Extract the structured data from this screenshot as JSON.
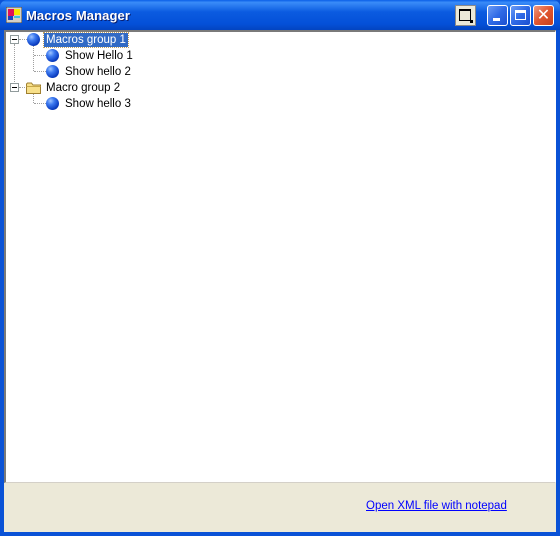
{
  "window": {
    "title": "Macros Manager",
    "title_icon": "app-icon",
    "controls": [
      {
        "name": "extra-button",
        "icon": "window-layout-icon"
      },
      {
        "name": "minimize-button",
        "icon": "minimize-icon"
      },
      {
        "name": "maximize-button",
        "icon": "maximize-icon"
      },
      {
        "name": "close-button",
        "icon": "close-icon",
        "glyph": "✕"
      }
    ]
  },
  "tree": {
    "nodes": [
      {
        "label": "Macros group 1",
        "icon": "ball-icon",
        "level": 0,
        "expanded": true,
        "selected": true
      },
      {
        "label": "Show Hello 1",
        "icon": "ball-icon",
        "level": 1
      },
      {
        "label": "Show hello 2",
        "icon": "ball-icon",
        "level": 1
      },
      {
        "label": "Macro group 2",
        "icon": "folder-icon",
        "level": 0,
        "expanded": true
      },
      {
        "label": "Show hello 3",
        "icon": "ball-icon",
        "level": 1
      }
    ]
  },
  "footer": {
    "link_label": "Open XML file with notepad"
  },
  "colors": {
    "titlebar": "#0450d8",
    "selection": "#316ac5",
    "link": "#0000ff",
    "panel": "#ece9d8"
  }
}
